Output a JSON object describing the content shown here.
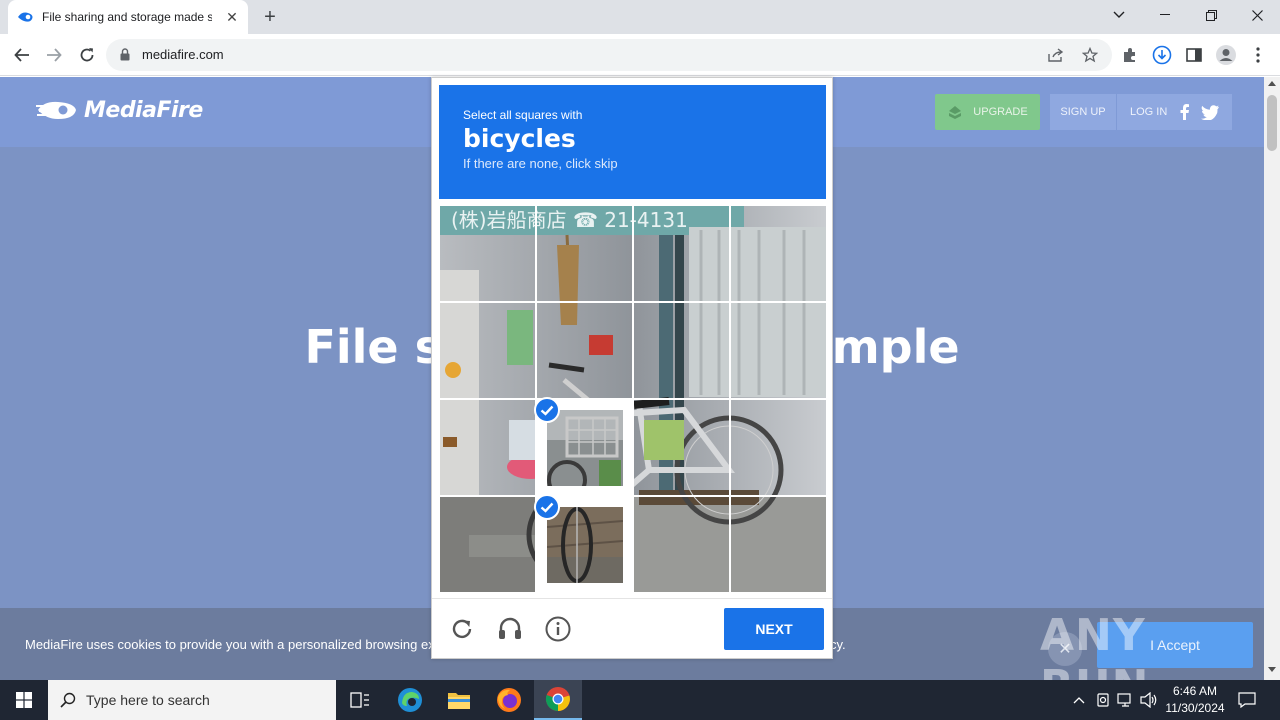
{
  "browser": {
    "tab_title": "File sharing and storage made simple",
    "url": "mediafire.com",
    "new_tab_label": "+"
  },
  "site": {
    "logo_text": "MediaFire",
    "upgrade_label": "UPGRADE",
    "signup_label": "SIGN UP",
    "login_label": "LOG IN",
    "headline": "File storage made simple",
    "cookie_text": "MediaFire uses cookies to provide you with a personalized browsing experience. By continuing to use this site, you agree to our Privacy Policy.",
    "accept_label": "I Accept"
  },
  "watermark": "ANY RUN",
  "captcha": {
    "prompt": "Select all squares with",
    "object": "bicycles",
    "skip_hint": "If there are none, click skip",
    "next_label": "NEXT",
    "grid_size": 4,
    "selected_tiles": [
      9,
      13
    ],
    "accent_color": "#1a73e8"
  },
  "taskbar": {
    "search_placeholder": "Type here to search",
    "time": "6:46 AM",
    "date": "11/30/2024"
  }
}
